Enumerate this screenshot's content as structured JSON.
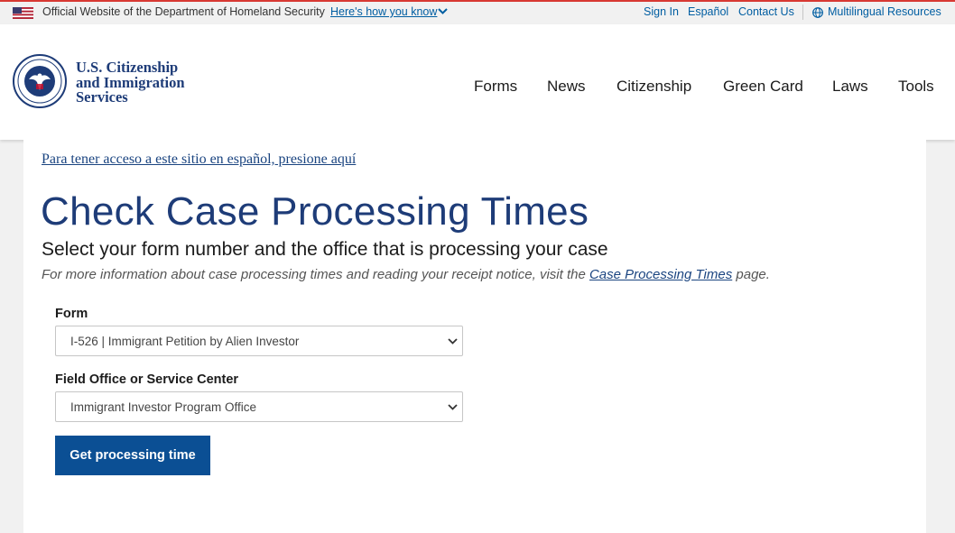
{
  "gov_banner": {
    "official_text": "Official Website of the Department of Homeland Security",
    "how_you_know": "Here's how you know",
    "links": [
      "Sign In",
      "Español",
      "Contact Us"
    ],
    "multilingual": "Multilingual Resources"
  },
  "brand": {
    "line1": "U.S. Citizenship",
    "line2": "and Immigration",
    "line3": "Services"
  },
  "nav": [
    "Forms",
    "News",
    "Citizenship",
    "Green Card",
    "Laws",
    "Tools"
  ],
  "main": {
    "spanish_link": "Para tener acceso a este sitio en español, presione aquí",
    "title": "Check Case Processing Times",
    "subtitle": "Select your form number and the office that is processing your case",
    "info_prefix": "For more information about case processing times and reading your receipt notice, visit the ",
    "info_link": "Case Processing Times",
    "info_suffix": " page."
  },
  "form": {
    "form_label": "Form",
    "form_value": "I-526 | Immigrant Petition by Alien Investor",
    "office_label": "Field Office or Service Center",
    "office_value": "Immigrant Investor Program Office",
    "submit_label": "Get processing time"
  },
  "colors": {
    "accent_red": "#d83933",
    "link_blue": "#005ea2",
    "title_blue": "#1e3c78",
    "button_blue": "#0b4f94"
  }
}
